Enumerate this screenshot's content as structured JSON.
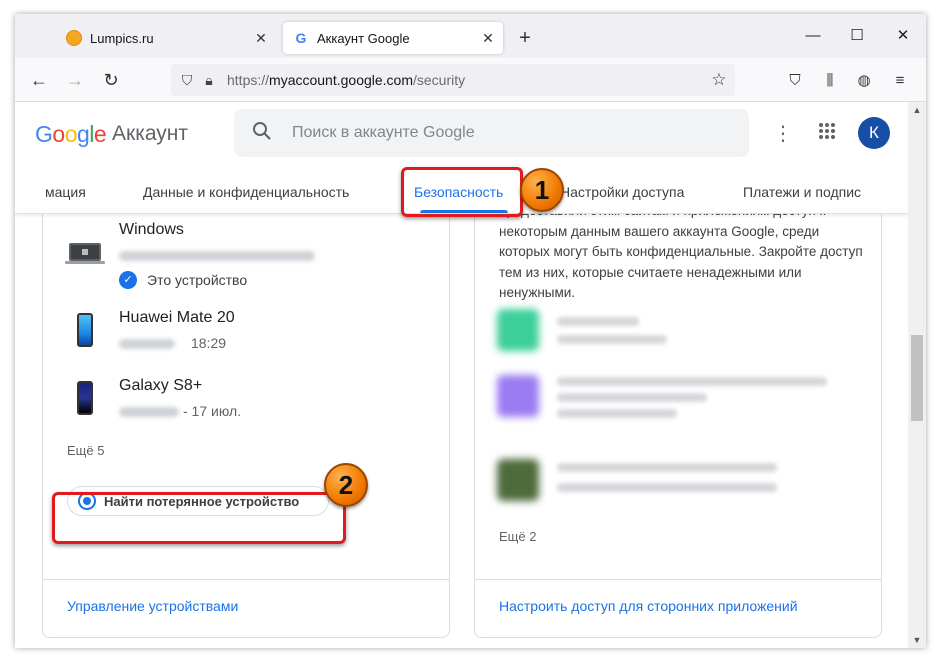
{
  "browser": {
    "tabs": [
      {
        "title": "Lumpics.ru"
      },
      {
        "title": "Аккаунт Google"
      }
    ],
    "new_tab": "+",
    "window_controls": {
      "minimize": "—",
      "maximize": "☐",
      "close": "✕"
    },
    "url": {
      "scheme": "https://",
      "host": "myaccount.google.com",
      "path": "/security"
    },
    "icons": [
      "back-icon",
      "forward-icon",
      "reload-icon",
      "shield-icon",
      "lock-icon",
      "star-icon",
      "pocket-icon",
      "library-icon",
      "globe-icon",
      "menu-icon"
    ]
  },
  "header": {
    "logo_letters": [
      "G",
      "o",
      "o",
      "g",
      "l",
      "e"
    ],
    "logo_colors": [
      "#4285F4",
      "#EA4335",
      "#FBBC05",
      "#4285F4",
      "#34A853",
      "#EA4335"
    ],
    "logo_sub": "Аккаунт",
    "search_placeholder": "Поиск в аккаунте Google",
    "avatar_letter": "К"
  },
  "nav": {
    "tabs": [
      {
        "label": "мация"
      },
      {
        "label": "Данные и конфиденциальность"
      },
      {
        "label": "Безопасность",
        "active": true
      },
      {
        "label": "Настройки доступа"
      },
      {
        "label": "Платежи и подпис"
      }
    ]
  },
  "devices_card": {
    "devices": [
      {
        "name": "Windows",
        "this_device": "Это устройство"
      },
      {
        "name": "Huawei Mate 20",
        "time": "18:29"
      },
      {
        "name": "Galaxy S8+",
        "time": "- 17 июл."
      }
    ],
    "more": "Ещё 5",
    "find_button": "Найти потерянное устройство",
    "footer_link": "Управление устройствами"
  },
  "apps_card": {
    "description": "предоставили этим сайтам и приложениям доступ к некоторым данным вашего аккаунта Google, среди которых могут быть конфиденциальные. Закройте доступ тем из них, которые считаете ненадежными или ненужными.",
    "more": "Ещё 2",
    "footer_link": "Настроить доступ для сторонних приложений",
    "app_icon_colors": [
      "#3ccf9a",
      "#9b7cf2",
      "#4e6b3c"
    ]
  },
  "annotations": {
    "badge_1": "1",
    "badge_2": "2",
    "color": "#E11B1B"
  }
}
